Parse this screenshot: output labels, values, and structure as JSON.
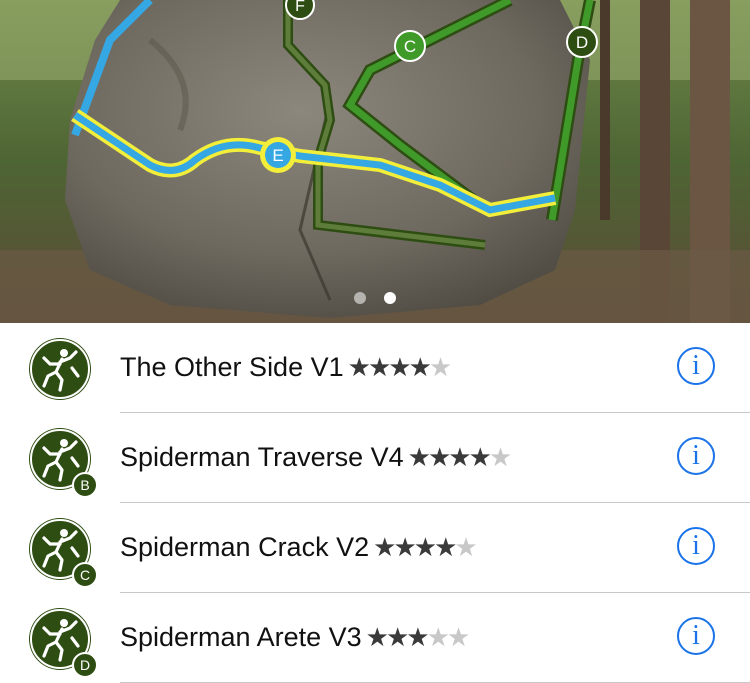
{
  "photo": {
    "markers": [
      "F",
      "C",
      "D",
      "E"
    ],
    "page_indicator": {
      "count": 2,
      "current": 2
    }
  },
  "routes": [
    {
      "name": "The Other Side",
      "grade": "V1",
      "rating": 4,
      "max_rating": 5,
      "badge": "",
      "icon": "climber-icon"
    },
    {
      "name": "Spiderman Traverse",
      "grade": "V4",
      "rating": 4,
      "max_rating": 5,
      "badge": "B",
      "icon": "climber-icon"
    },
    {
      "name": "Spiderman Crack",
      "grade": "V2",
      "rating": 4,
      "max_rating": 5,
      "badge": "C",
      "icon": "climber-icon"
    },
    {
      "name": "Spiderman Arete",
      "grade": "V3",
      "rating": 3,
      "max_rating": 5,
      "badge": "D",
      "icon": "climber-icon"
    }
  ],
  "colors": {
    "route_dark_green": "#2e4d12",
    "route_green": "#3f9a2a",
    "route_blue": "#35a7e3",
    "route_yellow": "#f2ee3a",
    "info_blue": "#1a73e8"
  }
}
